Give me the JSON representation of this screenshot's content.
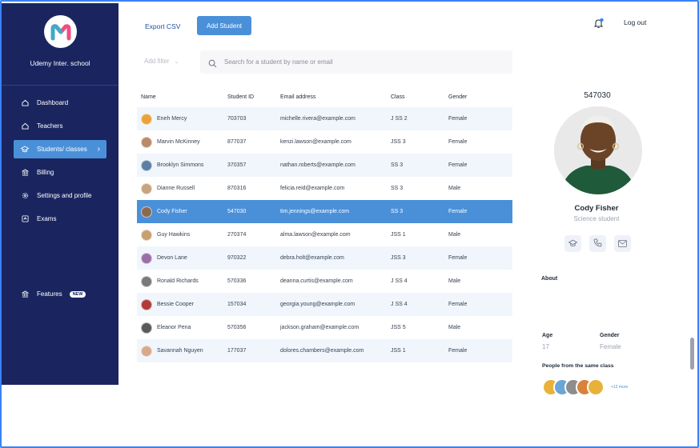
{
  "sidebar": {
    "school_name": "Udemy Inter. school",
    "items": [
      {
        "label": "Dashboard",
        "icon": "home-icon"
      },
      {
        "label": "Teachers",
        "icon": "home-icon"
      },
      {
        "label": "Students/ classes",
        "icon": "graduation-cap-icon",
        "active": true
      },
      {
        "label": "Billing",
        "icon": "bank-icon"
      },
      {
        "label": "Settings and profile",
        "icon": "gear-icon"
      },
      {
        "label": "Exams",
        "icon": "exam-icon"
      }
    ],
    "features": {
      "label": "Features",
      "badge": "NEW"
    }
  },
  "toolbar": {
    "export_label": "Export CSV",
    "add_label": "Add Student",
    "logout_label": "Log out",
    "filter_label": "Add filter",
    "search_placeholder": "Search for a student by name or email"
  },
  "table": {
    "headers": [
      "Name",
      "Student ID",
      "Email address",
      "Class",
      "Gender"
    ],
    "rows": [
      {
        "name": "Eneh Mercy",
        "id": "703703",
        "email": "michelle.rivera@example.com",
        "class": "J SS 2",
        "gender": "Female",
        "avatar": "#e9a23b"
      },
      {
        "name": "Marvin McKinney",
        "id": "877037",
        "email": "kenzi.lawson@example.com",
        "class": "JSS 3",
        "gender": "Female",
        "avatar": "#b98a6a"
      },
      {
        "name": "Brooklyn Simmons",
        "id": "370357",
        "email": "nathan.roberts@example.com",
        "class": "SS 3",
        "gender": "Female",
        "avatar": "#5b7fa3"
      },
      {
        "name": "Dianne Russell",
        "id": "870316",
        "email": "felicia.reid@example.com",
        "class": "SS 3",
        "gender": "Male",
        "avatar": "#c9a27e"
      },
      {
        "name": "Cody Fisher",
        "id": "547030",
        "email": "tim.jennings@example.com",
        "class": "SS 3",
        "gender": "Female",
        "avatar": "#8a6a52",
        "selected": true
      },
      {
        "name": "Guy Hawkins",
        "id": "270374",
        "email": "alma.lawson@example.com",
        "class": "JSS 1",
        "gender": "Male",
        "avatar": "#c7a070"
      },
      {
        "name": "Devon Lane",
        "id": "970322",
        "email": "debra.holt@example.com",
        "class": "JSS 3",
        "gender": "Female",
        "avatar": "#9a6fa8"
      },
      {
        "name": "Ronald Richards",
        "id": "570336",
        "email": "deanna.curtis@example.com",
        "class": "J SS 4",
        "gender": "Male",
        "avatar": "#7a7a7a"
      },
      {
        "name": "Bessie Cooper",
        "id": "157034",
        "email": "georgia.young@example.com",
        "class": "J SS 4",
        "gender": "Female",
        "avatar": "#b23a3a"
      },
      {
        "name": "Eleanor Pena",
        "id": "570356",
        "email": "jackson.graham@example.com",
        "class": "JSS 5",
        "gender": "Male",
        "avatar": "#5a5a5a"
      },
      {
        "name": "Savannah Nguyen",
        "id": "177037",
        "email": "dolores.chambers@example.com",
        "class": "JSS 1",
        "gender": "Female",
        "avatar": "#d8a889"
      }
    ]
  },
  "profile": {
    "student_id": "547030",
    "name": "Cody Fisher",
    "role": "Science student",
    "about_label": "About",
    "age_label": "Age",
    "age_value": "17",
    "gender_label": "Gender",
    "gender_value": "Female",
    "same_class_label": "People from the same class",
    "more_label": "+12 more",
    "classmate_colors": [
      "#e8b23a",
      "#6aa6d6",
      "#8d8d8d",
      "#d9823b",
      "#e8b23a"
    ]
  },
  "colors": {
    "sidebar_bg": "#1a2560",
    "accent": "#4a90d9",
    "row_alt": "#f1f6fd"
  }
}
